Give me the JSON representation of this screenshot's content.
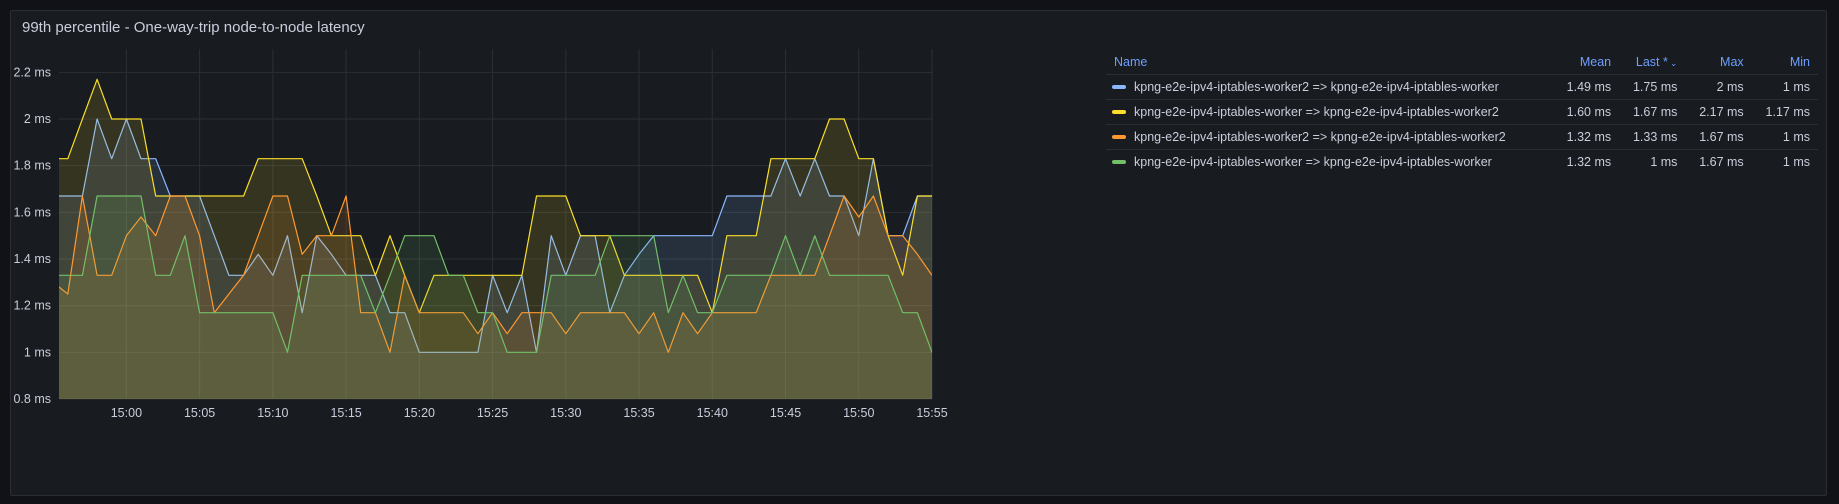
{
  "panel": {
    "title": "99th percentile - One-way-trip node-to-node latency"
  },
  "legend": {
    "headers": {
      "name": "Name",
      "mean": "Mean",
      "last": "Last *",
      "max": "Max",
      "min": "Min"
    },
    "sort_icon": "chevron-down-icon",
    "rows": [
      {
        "name": "kpng-e2e-ipv4-iptables-worker2 => kpng-e2e-ipv4-iptables-worker",
        "mean": "1.49 ms",
        "last": "1.75 ms",
        "max": "2 ms",
        "min": "1 ms",
        "color": "#8ab8ff"
      },
      {
        "name": "kpng-e2e-ipv4-iptables-worker => kpng-e2e-ipv4-iptables-worker2",
        "mean": "1.60 ms",
        "last": "1.67 ms",
        "max": "2.17 ms",
        "min": "1.17 ms",
        "color": "#fade2a"
      },
      {
        "name": "kpng-e2e-ipv4-iptables-worker2 => kpng-e2e-ipv4-iptables-worker2",
        "mean": "1.32 ms",
        "last": "1.33 ms",
        "max": "1.67 ms",
        "min": "1 ms",
        "color": "#ff9830"
      },
      {
        "name": "kpng-e2e-ipv4-iptables-worker => kpng-e2e-ipv4-iptables-worker",
        "mean": "1.32 ms",
        "last": "1 ms",
        "max": "1.67 ms",
        "min": "1 ms",
        "color": "#73bf69"
      }
    ]
  },
  "chart_data": {
    "type": "area",
    "x_start_minute": -5,
    "x_step_minutes": 1,
    "xlim": [
      -4.6,
      55.0
    ],
    "ylim": [
      0.8,
      2.3
    ],
    "x_ticks": [
      {
        "label": "15:00",
        "value": 0
      },
      {
        "label": "15:05",
        "value": 5
      },
      {
        "label": "15:10",
        "value": 10
      },
      {
        "label": "15:15",
        "value": 15
      },
      {
        "label": "15:20",
        "value": 20
      },
      {
        "label": "15:25",
        "value": 25
      },
      {
        "label": "15:30",
        "value": 30
      },
      {
        "label": "15:35",
        "value": 35
      },
      {
        "label": "15:40",
        "value": 40
      },
      {
        "label": "15:45",
        "value": 45
      },
      {
        "label": "15:50",
        "value": 50
      },
      {
        "label": "15:55",
        "value": 55
      }
    ],
    "y_ticks": [
      {
        "label": "0.8 ms",
        "value": 0.8
      },
      {
        "label": "1 ms",
        "value": 1.0
      },
      {
        "label": "1.2 ms",
        "value": 1.2
      },
      {
        "label": "1.4 ms",
        "value": 1.4
      },
      {
        "label": "1.6 ms",
        "value": 1.6
      },
      {
        "label": "1.8 ms",
        "value": 1.8
      },
      {
        "label": "2 ms",
        "value": 2.0
      },
      {
        "label": "2.2 ms",
        "value": 2.2
      }
    ],
    "grid": true,
    "legend_position": "right",
    "series": [
      {
        "name": "kpng-e2e-ipv4-iptables-worker2 => kpng-e2e-ipv4-iptables-worker",
        "color": "#8ab8ff",
        "values": [
          1.67,
          1.67,
          1.67,
          2.0,
          1.83,
          2.0,
          1.83,
          1.83,
          1.67,
          1.67,
          1.67,
          1.5,
          1.33,
          1.33,
          1.42,
          1.33,
          1.5,
          1.17,
          1.5,
          1.42,
          1.33,
          1.33,
          1.33,
          1.17,
          1.17,
          1.0,
          1.0,
          1.0,
          1.0,
          1.0,
          1.33,
          1.17,
          1.33,
          1.0,
          1.5,
          1.33,
          1.5,
          1.5,
          1.17,
          1.33,
          1.42,
          1.5,
          1.5,
          1.5,
          1.5,
          1.5,
          1.67,
          1.67,
          1.67,
          1.67,
          1.83,
          1.67,
          1.83,
          1.67,
          1.67,
          1.5,
          1.83,
          1.5,
          1.5,
          1.67,
          1.67,
          1.67,
          1.67,
          1.67,
          1.75
        ]
      },
      {
        "name": "kpng-e2e-ipv4-iptables-worker => kpng-e2e-ipv4-iptables-worker2",
        "color": "#fade2a",
        "values": [
          1.83,
          1.83,
          2.0,
          2.17,
          2.0,
          2.0,
          2.0,
          1.67,
          1.67,
          1.67,
          1.67,
          1.67,
          1.67,
          1.67,
          1.83,
          1.83,
          1.83,
          1.83,
          1.67,
          1.5,
          1.5,
          1.5,
          1.33,
          1.5,
          1.33,
          1.17,
          1.33,
          1.33,
          1.33,
          1.33,
          1.33,
          1.33,
          1.33,
          1.67,
          1.67,
          1.67,
          1.5,
          1.5,
          1.5,
          1.33,
          1.33,
          1.33,
          1.33,
          1.33,
          1.33,
          1.17,
          1.5,
          1.5,
          1.5,
          1.83,
          1.83,
          1.83,
          1.83,
          2.0,
          2.0,
          1.83,
          1.83,
          1.5,
          1.33,
          1.67,
          1.67,
          1.67,
          1.5,
          1.17,
          1.67
        ]
      },
      {
        "name": "kpng-e2e-ipv4-iptables-worker2 => kpng-e2e-ipv4-iptables-worker2",
        "color": "#ff9830",
        "values": [
          1.3,
          1.25,
          1.67,
          1.33,
          1.33,
          1.5,
          1.58,
          1.5,
          1.67,
          1.67,
          1.5,
          1.17,
          1.25,
          1.33,
          1.5,
          1.67,
          1.67,
          1.42,
          1.5,
          1.5,
          1.67,
          1.17,
          1.17,
          1.0,
          1.33,
          1.17,
          1.17,
          1.17,
          1.17,
          1.08,
          1.17,
          1.08,
          1.17,
          1.17,
          1.17,
          1.08,
          1.17,
          1.17,
          1.17,
          1.17,
          1.08,
          1.17,
          1.0,
          1.17,
          1.08,
          1.17,
          1.17,
          1.17,
          1.17,
          1.33,
          1.33,
          1.33,
          1.33,
          1.5,
          1.67,
          1.58,
          1.67,
          1.5,
          1.5,
          1.42,
          1.33
        ]
      },
      {
        "name": "kpng-e2e-ipv4-iptables-worker => kpng-e2e-ipv4-iptables-worker",
        "color": "#73bf69",
        "values": [
          1.33,
          1.33,
          1.33,
          1.67,
          1.67,
          1.67,
          1.67,
          1.33,
          1.33,
          1.5,
          1.17,
          1.17,
          1.17,
          1.17,
          1.17,
          1.17,
          1.0,
          1.33,
          1.33,
          1.33,
          1.33,
          1.33,
          1.17,
          1.33,
          1.5,
          1.5,
          1.5,
          1.33,
          1.33,
          1.17,
          1.17,
          1.0,
          1.0,
          1.0,
          1.33,
          1.33,
          1.33,
          1.33,
          1.5,
          1.5,
          1.5,
          1.5,
          1.17,
          1.33,
          1.17,
          1.17,
          1.33,
          1.33,
          1.33,
          1.33,
          1.5,
          1.33,
          1.5,
          1.33,
          1.33,
          1.33,
          1.33,
          1.33,
          1.17,
          1.17,
          1.0,
          1.0
        ]
      }
    ]
  }
}
